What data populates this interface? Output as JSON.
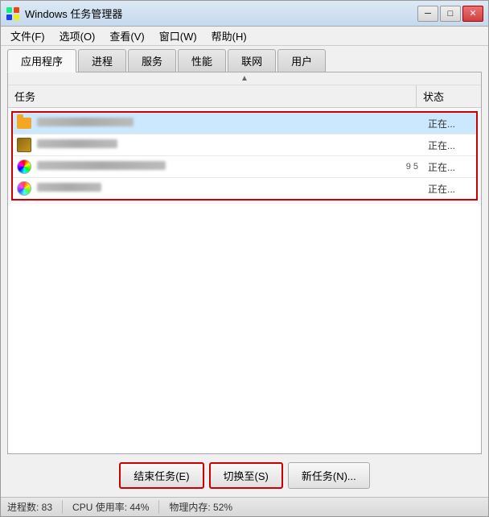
{
  "window": {
    "title": "Windows 任务管理器",
    "controls": {
      "minimize": "─",
      "maximize": "□",
      "close": "✕"
    }
  },
  "menu": {
    "items": [
      {
        "id": "file",
        "label": "文件(F)"
      },
      {
        "id": "options",
        "label": "选项(O)"
      },
      {
        "id": "view",
        "label": "查看(V)"
      },
      {
        "id": "window",
        "label": "窗口(W)"
      },
      {
        "id": "help",
        "label": "帮助(H)"
      }
    ]
  },
  "tabs": [
    {
      "id": "apps",
      "label": "应用程序",
      "active": true
    },
    {
      "id": "processes",
      "label": "进程",
      "active": false
    },
    {
      "id": "services",
      "label": "服务",
      "active": false
    },
    {
      "id": "performance",
      "label": "性能",
      "active": false
    },
    {
      "id": "network",
      "label": "联网",
      "active": false
    },
    {
      "id": "users",
      "label": "用户",
      "active": false
    }
  ],
  "table": {
    "col_task": "任务",
    "col_status": "状态"
  },
  "tasks": [
    {
      "id": 1,
      "icon": "folder",
      "name": "3D...",
      "extra": "",
      "status": "正在..."
    },
    {
      "id": 2,
      "icon": "package",
      "name": "X...",
      "extra": "",
      "status": "正在..."
    },
    {
      "id": 3,
      "icon": "colorwheel",
      "name": "高...",
      "extra": "9 5",
      "status": "正在..."
    },
    {
      "id": 4,
      "icon": "colorwheel2",
      "name": "─...",
      "extra": "",
      "status": "正在..."
    }
  ],
  "buttons": {
    "end_task": "结束任务(E)",
    "switch_to": "切换至(S)",
    "new_task": "新任务(N)..."
  },
  "statusbar": {
    "processes": "进程数: 83",
    "cpu": "CPU 使用率: 44%",
    "memory": "物理内存: 52%"
  }
}
